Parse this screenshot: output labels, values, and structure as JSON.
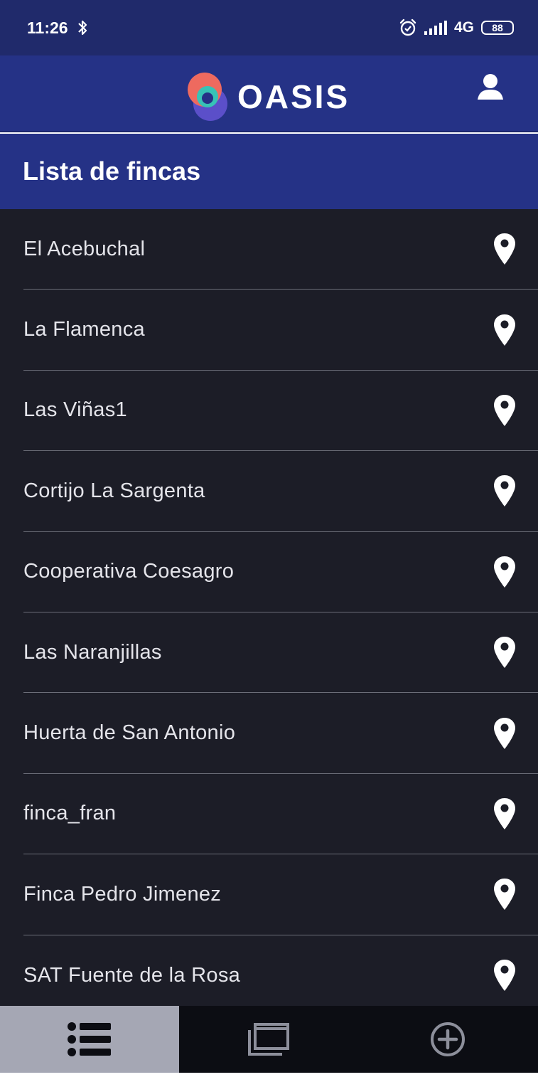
{
  "status_bar": {
    "time": "11:26",
    "network": "4G",
    "battery": "88"
  },
  "header": {
    "app_name": "OASIS"
  },
  "page": {
    "title": "Lista de fincas"
  },
  "fincas": [
    "El Acebuchal",
    "La Flamenca",
    "Las Viñas1",
    "Cortijo La Sargenta",
    "Cooperativa Coesagro",
    "Las Naranjillas",
    "Huerta de San Antonio",
    "finca_fran",
    "Finca Pedro Jimenez",
    "SAT Fuente de la Rosa"
  ],
  "icons": {
    "status": [
      "bluetooth-icon",
      "alarm-icon",
      "signal-icon",
      "battery-icon"
    ],
    "header": [
      "oasis-logo-icon",
      "user-profile-icon"
    ],
    "list_item": "location-pin-icon",
    "bottom_nav": [
      "list-icon",
      "folder-icon",
      "add-circle-icon"
    ]
  },
  "colors": {
    "status_bar": "#202a6b",
    "primary": "#253286",
    "list_background": "#1c1d27",
    "active_tab": "#a5a7b4",
    "logo_coral": "#ee6a5f",
    "logo_teal": "#37c3b6",
    "logo_purple": "#5b4fc9"
  }
}
